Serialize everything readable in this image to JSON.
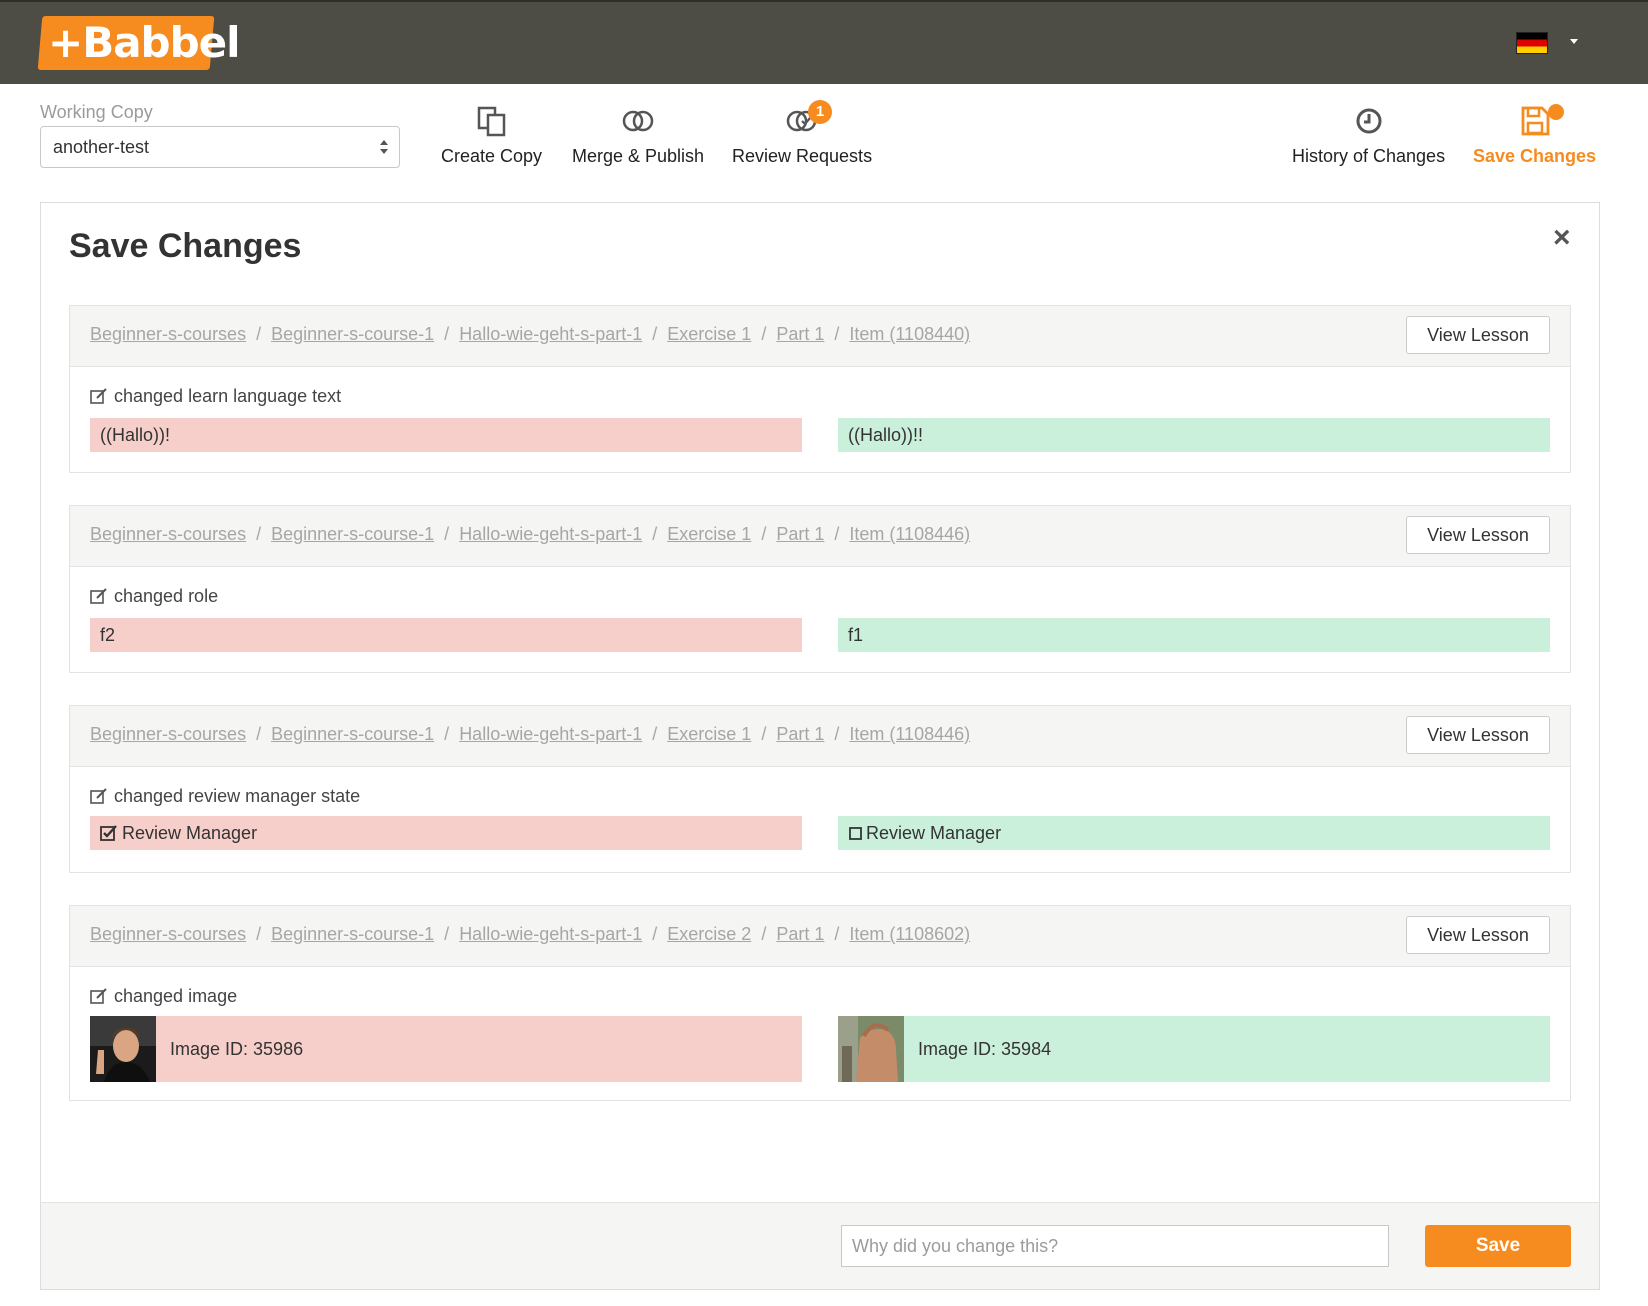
{
  "header": {
    "logo": "+Babbel",
    "language_flag": "germany-flag-icon"
  },
  "toolbar": {
    "working_copy_label": "Working Copy",
    "working_copy_value": "another-test",
    "create_copy": "Create Copy",
    "merge_publish": "Merge & Publish",
    "review_requests": "Review Requests",
    "review_requests_count": "1",
    "history": "History of Changes",
    "save_changes": "Save Changes"
  },
  "colors": {
    "accent": "#f68b1f",
    "header_bg": "#4d4d45",
    "old_value_bg": "#f7cfca",
    "new_value_bg": "#caf0dc"
  },
  "panel": {
    "title": "Save Changes",
    "close": "×",
    "view_lesson": "View Lesson",
    "changes": [
      {
        "breadcrumb": [
          "Beginner-s-courses",
          "Beginner-s-course-1",
          "Hallo-wie-geht-s-part-1",
          "Exercise 1",
          "Part 1",
          "Item (1108440)"
        ],
        "label": "changed learn language text",
        "old": "((Hallo))!",
        "new": "((Hallo))!!"
      },
      {
        "breadcrumb": [
          "Beginner-s-courses",
          "Beginner-s-course-1",
          "Hallo-wie-geht-s-part-1",
          "Exercise 1",
          "Part 1",
          "Item (1108446)"
        ],
        "label": "changed role",
        "old": "f2",
        "new": "f1"
      },
      {
        "breadcrumb": [
          "Beginner-s-courses",
          "Beginner-s-course-1",
          "Hallo-wie-geht-s-part-1",
          "Exercise 1",
          "Part 1",
          "Item (1108446)"
        ],
        "label": "changed review manager state",
        "old": "Review Manager",
        "old_checked": true,
        "new": "Review Manager",
        "new_checked": false
      },
      {
        "breadcrumb": [
          "Beginner-s-courses",
          "Beginner-s-course-1",
          "Hallo-wie-geht-s-part-1",
          "Exercise 2",
          "Part 1",
          "Item (1108602)"
        ],
        "label": "changed image",
        "old": "Image ID: 35986",
        "new": "Image ID: 35984"
      }
    ]
  },
  "footer": {
    "reason_placeholder": "Why did you change this?",
    "save": "Save"
  }
}
